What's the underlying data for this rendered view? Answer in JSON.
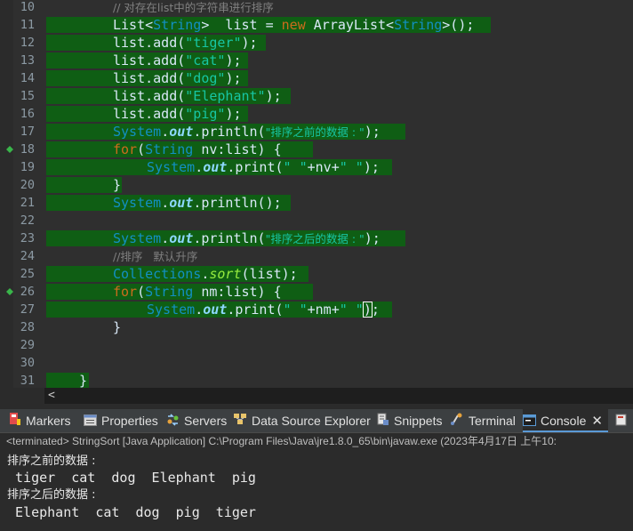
{
  "editor": {
    "lines": [
      {
        "num": "10",
        "comment": "// 对存在list中的字符串进行排序"
      },
      {
        "num": "11",
        "t1": "List<",
        "t2": "String",
        "t3": ">  list = ",
        "kw": "new",
        "t4": " ArrayList<",
        "t5": "String",
        "t6": ">();"
      },
      {
        "num": "12",
        "text": "list.add(",
        "str": "\"tiger\"",
        "end": ");"
      },
      {
        "num": "13",
        "text": "list.add(",
        "str": "\"cat\"",
        "end": ");"
      },
      {
        "num": "14",
        "text": "list.add(",
        "str": "\"dog\"",
        "end": ");"
      },
      {
        "num": "15",
        "text": "list.add(",
        "str": "\"Elephant\"",
        "end": ");"
      },
      {
        "num": "16",
        "text": "list.add(",
        "str": "\"pig\"",
        "end": ");"
      },
      {
        "num": "17",
        "cls": "System",
        "dot": ".",
        "field": "out",
        "call": ".println(",
        "str": "\"排序之前的数据 : \"",
        "end": ");"
      },
      {
        "num": "18",
        "kw": "for",
        "p1": "(",
        "type": "String",
        "rest": " nv:list) {"
      },
      {
        "num": "19",
        "cls": "System",
        "dot": ".",
        "field": "out",
        "call": ".print(",
        "str": "\" \"",
        "mid": "+nv+",
        "str2": "\" \"",
        "end": ");"
      },
      {
        "num": "20",
        "text": "}"
      },
      {
        "num": "21",
        "cls": "System",
        "dot": ".",
        "field": "out",
        "call": ".println();"
      },
      {
        "num": "22"
      },
      {
        "num": "23",
        "cls": "System",
        "dot": ".",
        "field": "out",
        "call": ".println(",
        "str": "\"排序之后的数据 : \"",
        "end": ");"
      },
      {
        "num": "24",
        "comment": "//排序   默认升序"
      },
      {
        "num": "25",
        "cls": "Collections",
        "dot": ".",
        "sm": "sort",
        "call": "(list);"
      },
      {
        "num": "26",
        "kw": "for",
        "p1": "(",
        "type": "String",
        "rest": " nm:list) {"
      },
      {
        "num": "27",
        "cls": "System",
        "dot": ".",
        "field": "out",
        "call": ".print(",
        "str": "\" \"",
        "mid": "+nm+",
        "str2": "\" \"",
        "caret": ")",
        "end": ";"
      },
      {
        "num": "28",
        "text": "}"
      },
      {
        "num": "29"
      },
      {
        "num": "30"
      },
      {
        "num": "31",
        "text": "}"
      }
    ],
    "hscroll_arrow": "<"
  },
  "views": {
    "markers": "Markers",
    "properties": "Properties",
    "servers": "Servers",
    "data_source": "Data Source Explorer",
    "snippets": "Snippets",
    "terminal": "Terminal",
    "console": "Console",
    "close": "✕"
  },
  "status": "<terminated> StringSort [Java Application] C:\\Program Files\\Java\\jre1.8.0_65\\bin\\javaw.exe  (2023年4月17日 上午10:",
  "console": {
    "line1": "排序之前的数据 :",
    "line2": " tiger  cat  dog  Elephant  pig",
    "line3": "排序之后的数据 :",
    "line4": " Elephant  cat  dog  pig  tiger"
  }
}
